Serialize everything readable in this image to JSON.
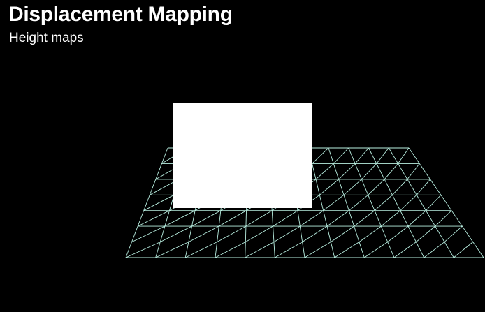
{
  "slide": {
    "title": "Displacement Mapping",
    "subtitle": "Height maps"
  },
  "mesh": {
    "description_icon": "wireframe-plane",
    "line_color": "#b9efe1",
    "background_color": "#000000"
  },
  "height_map": {
    "fill_color": "#ffffff"
  }
}
